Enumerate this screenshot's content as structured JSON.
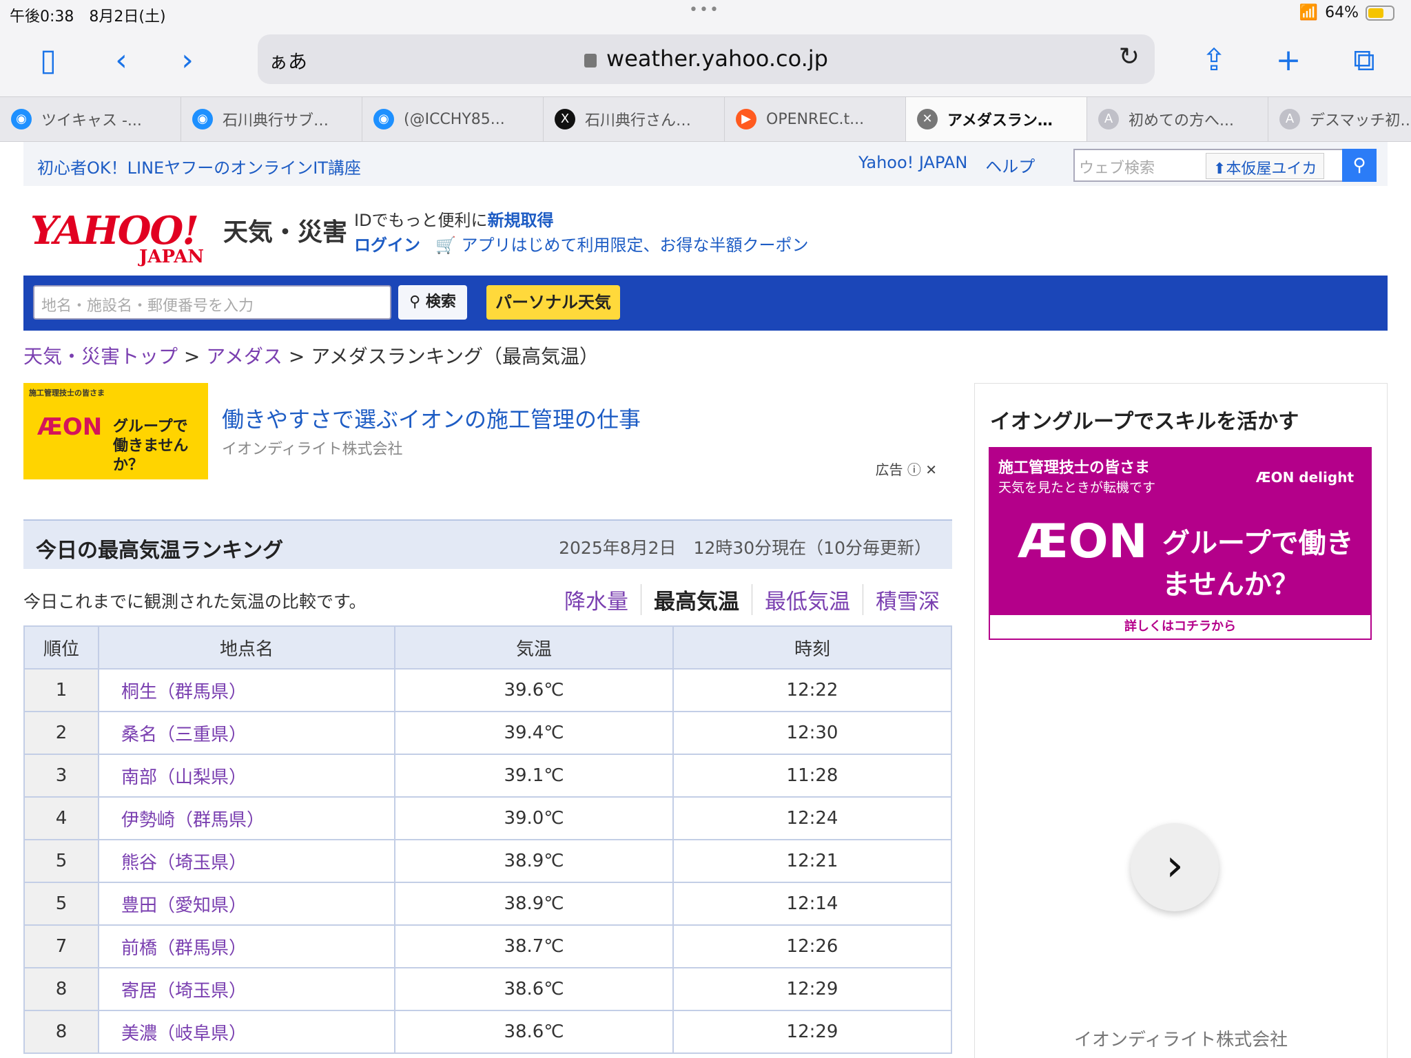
{
  "status": {
    "time": "午後0:38　8月2日(土)",
    "dots": "•••",
    "battery": "64%"
  },
  "browser": {
    "aa": "ぁあ",
    "url": "weather.yahoo.co.jp",
    "tabs": [
      {
        "label": "ツイキャス -...",
        "color": "#1e90ff",
        "glyph": "◉"
      },
      {
        "label": "石川典行サブ…",
        "color": "#1e90ff",
        "glyph": "◉"
      },
      {
        "label": "(@ICCHY85...",
        "color": "#1e90ff",
        "glyph": "◉"
      },
      {
        "label": "石川典行さん…",
        "color": "#111111",
        "glyph": "X"
      },
      {
        "label": "OPENREC.t...",
        "color": "#ff5a1f",
        "glyph": "▶"
      },
      {
        "label": "アメダスラン…",
        "color": "#777777",
        "glyph": "✕",
        "active": true
      },
      {
        "label": "初めての方へ...",
        "color": "#c0c0c8",
        "glyph": "A"
      },
      {
        "label": "デスマッチ初…",
        "color": "#c0c0c8",
        "glyph": "A"
      }
    ]
  },
  "topnav": {
    "promo": "初心者OK！LINEヤフーのオンラインIT講座",
    "link1": "Yahoo! JAPAN",
    "link2": "ヘルプ",
    "search_placeholder": "ウェブ検索",
    "user": "本仮屋ユイカ"
  },
  "brand": {
    "logo": "YAHOO!",
    "logo_sub": "JAPAN",
    "service": "天気・災害",
    "id_text": "IDでもっと便利に",
    "signup": "新規取得",
    "login": "ログイン",
    "coupon": "アプリはじめて利用限定、お得な半額クーポン"
  },
  "searchbar": {
    "placeholder": "地名・施設名・郵便番号を入力",
    "search_btn": "検索",
    "personal_btn": "パーソナル天気"
  },
  "breadcrumb": {
    "home": "天気・災害トップ",
    "amedas": "アメダス",
    "current": "アメダスランキング（最高気温）",
    "sep": ">"
  },
  "ad": {
    "img_top": "施工管理技士の皆さま",
    "img_brand": "ÆON",
    "img_copy": "グループで働きませんか？",
    "title": "働きやすさで選ぶイオンの施工管理の仕事",
    "company": "イオンディライト株式会社",
    "label": "広告 ⓘ ✕"
  },
  "ranking": {
    "heading": "今日の最高気温ランキング",
    "datetime": "2025年8月2日　12時30分現在（10分毎更新）",
    "description": "今日これまでに観測された気温の比較です。",
    "metrics": [
      "降水量",
      "最高気温",
      "最低気温",
      "積雪深"
    ],
    "columns": [
      "順位",
      "地点名",
      "気温",
      "時刻"
    ],
    "rows": [
      {
        "rank": "1",
        "station": "桐生（群馬県）",
        "temp": "39.6℃",
        "time": "12:22"
      },
      {
        "rank": "2",
        "station": "桑名（三重県）",
        "temp": "39.4℃",
        "time": "12:30"
      },
      {
        "rank": "3",
        "station": "南部（山梨県）",
        "temp": "39.1℃",
        "time": "11:28"
      },
      {
        "rank": "4",
        "station": "伊勢崎（群馬県）",
        "temp": "39.0℃",
        "time": "12:24"
      },
      {
        "rank": "5",
        "station": "熊谷（埼玉県）",
        "temp": "38.9℃",
        "time": "12:21"
      },
      {
        "rank": "5",
        "station": "豊田（愛知県）",
        "temp": "38.9℃",
        "time": "12:14"
      },
      {
        "rank": "7",
        "station": "前橋（群馬県）",
        "temp": "38.7℃",
        "time": "12:26"
      },
      {
        "rank": "8",
        "station": "寄居（埼玉県）",
        "temp": "38.6℃",
        "time": "12:29"
      },
      {
        "rank": "8",
        "station": "美濃（岐阜県）",
        "temp": "38.6℃",
        "time": "12:29"
      }
    ]
  },
  "side": {
    "heading": "イオングループでスキルを活かす",
    "b1": "施工管理技士の皆さま",
    "b2": "天気を見たときが転機です",
    "b3": "ÆON delight",
    "b4": "ÆON",
    "b5": "グループで働きませんか？",
    "b6": "詳しくはコチラから",
    "company": "イオンディライト株式会社"
  }
}
